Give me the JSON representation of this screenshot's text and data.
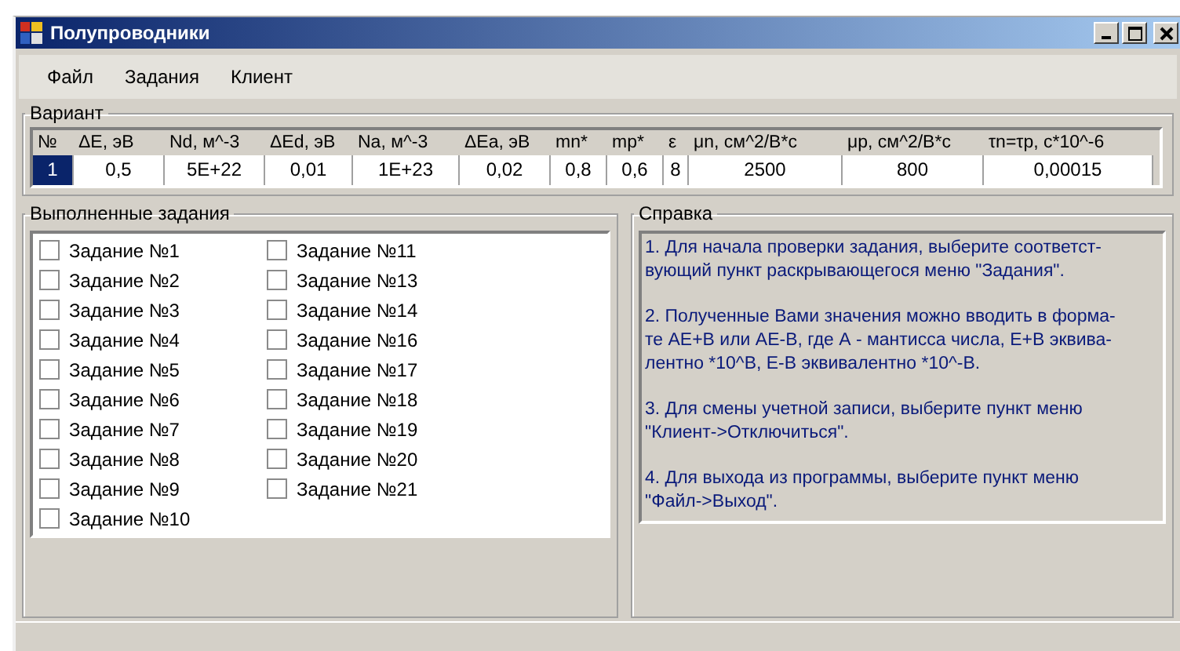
{
  "window": {
    "title": "Полупроводники"
  },
  "menu": [
    {
      "label": "Файл"
    },
    {
      "label": "Задания"
    },
    {
      "label": "Клиент"
    }
  ],
  "variant": {
    "title": "Вариант",
    "columns": [
      "№",
      "ΔE, эВ",
      "Nd, м^-3",
      "ΔEd, эВ",
      "Na, м^-3",
      "ΔEa, эВ",
      "mn*",
      "mp*",
      "ε",
      "μn, см^2/В*с",
      "μp, см^2/В*с",
      "τn=τp, с*10^-6"
    ],
    "rows": [
      {
        "cells": [
          "1",
          "0,5",
          "5E+22",
          "0,01",
          "1E+23",
          "0,02",
          "0,8",
          "0,6",
          "8",
          "2500",
          "800",
          "0,00015"
        ],
        "selected": true
      }
    ]
  },
  "tasks": {
    "title": "Выполненные задания",
    "items": [
      {
        "label": "Задание №1",
        "checked": false
      },
      {
        "label": "Задание №2",
        "checked": false
      },
      {
        "label": "Задание №3",
        "checked": false
      },
      {
        "label": "Задание №4",
        "checked": false
      },
      {
        "label": "Задание №5",
        "checked": false
      },
      {
        "label": "Задание №6",
        "checked": false
      },
      {
        "label": "Задание №7",
        "checked": false
      },
      {
        "label": "Задание №8",
        "checked": false
      },
      {
        "label": "Задание №9",
        "checked": false
      },
      {
        "label": "Задание №10",
        "checked": false
      },
      {
        "label": "Задание №11",
        "checked": false
      },
      {
        "label": "Задание №13",
        "checked": false
      },
      {
        "label": "Задание №14",
        "checked": false
      },
      {
        "label": "Задание №16",
        "checked": false
      },
      {
        "label": "Задание №17",
        "checked": false
      },
      {
        "label": "Задание №18",
        "checked": false
      },
      {
        "label": "Задание №19",
        "checked": false
      },
      {
        "label": "Задание №20",
        "checked": false
      },
      {
        "label": "Задание №21",
        "checked": false
      }
    ]
  },
  "help": {
    "title": "Справка",
    "paragraphs": [
      "1. Для начала проверки задания, выберите соответст-\nвующий пункт раскрывающегося меню \"Задания\".",
      "2. Полученные Вами значения можно вводить в форма-\nте АЕ+В или АЕ-В, где А - мантисса числа, Е+В эквива-\nлентно *10^В, Е-В эквивалентно *10^-В.",
      "3. Для смены учетной записи, выберите пункт меню\n\"Клиент->Отключиться\".",
      "4. Для выхода из программы, выберите пункт меню\n\"Файл->Выход\"."
    ]
  }
}
